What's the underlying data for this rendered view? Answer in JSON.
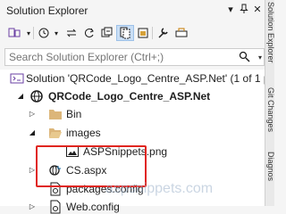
{
  "window": {
    "title": "Solution Explorer"
  },
  "search": {
    "placeholder": "Search Solution Explorer (Ctrl+;)"
  },
  "tree": {
    "solution_label": "Solution 'QRCode_Logo_Centre_ASP.Net' (1 of 1 p",
    "project_label": "QRCode_Logo_Centre_ASP.Net",
    "items": {
      "bin": "Bin",
      "images": "images",
      "image_file": "ASPSnippets.png",
      "cs_aspx": "CS.aspx",
      "packages": "packages.config",
      "webconfig": "Web.config"
    }
  },
  "side_tabs": [
    "Solution Explorer",
    "Git Changes",
    "Diagnos"
  ],
  "watermark": "aspsnippets.com",
  "colors": {
    "highlight": "#e0251f",
    "accent": "#0e639c"
  }
}
